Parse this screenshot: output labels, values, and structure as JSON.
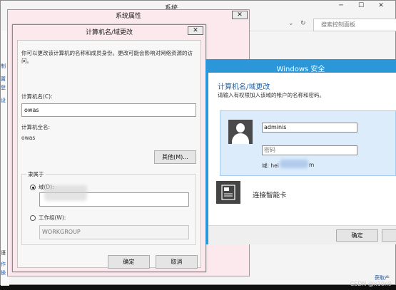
{
  "background_window": {
    "title": "系统",
    "minimize": "─",
    "maximize": "☐",
    "close": "✕",
    "search_placeholder": "搜索控制面板",
    "dropdown": "⌄",
    "refresh": "↻",
    "left_links": [
      "制",
      "置",
      "登",
      "设"
    ],
    "bottom_links": [
      "语",
      "作",
      "操"
    ],
    "bottom_right": "获取产"
  },
  "system_properties": {
    "title": "系统属性",
    "close": "✕"
  },
  "computer_name_dialog": {
    "title": "计算机名/域更改",
    "close": "✕",
    "description": "你可以更改该计算机的名称和成员身份。更改可能会影响对网络资源的访问。",
    "computer_name_label": "计算机名(C):",
    "computer_name_value": "owas",
    "full_name_label": "计算机全名:",
    "full_name_value": "owas",
    "other_button": "其他(M)...",
    "member_of_label": "隶属于",
    "domain_label": "域(D):",
    "domain_value": "",
    "workgroup_label": "工作组(W):",
    "workgroup_value": "WORKGROUP",
    "ok_button": "确定",
    "cancel_button": "取消"
  },
  "windows_security": {
    "title": "Windows 安全",
    "heading": "计算机名/域更改",
    "subtitle": "请输入有权限加入该域的帐户的名称和密码。",
    "username_value": "adminis",
    "password_placeholder": "密码",
    "domain_prefix": "域: hei",
    "domain_suffix": "m",
    "smartcard_label": "连接智能卡",
    "ok_button": "确定"
  },
  "watermark": "CSDN @x10n9"
}
